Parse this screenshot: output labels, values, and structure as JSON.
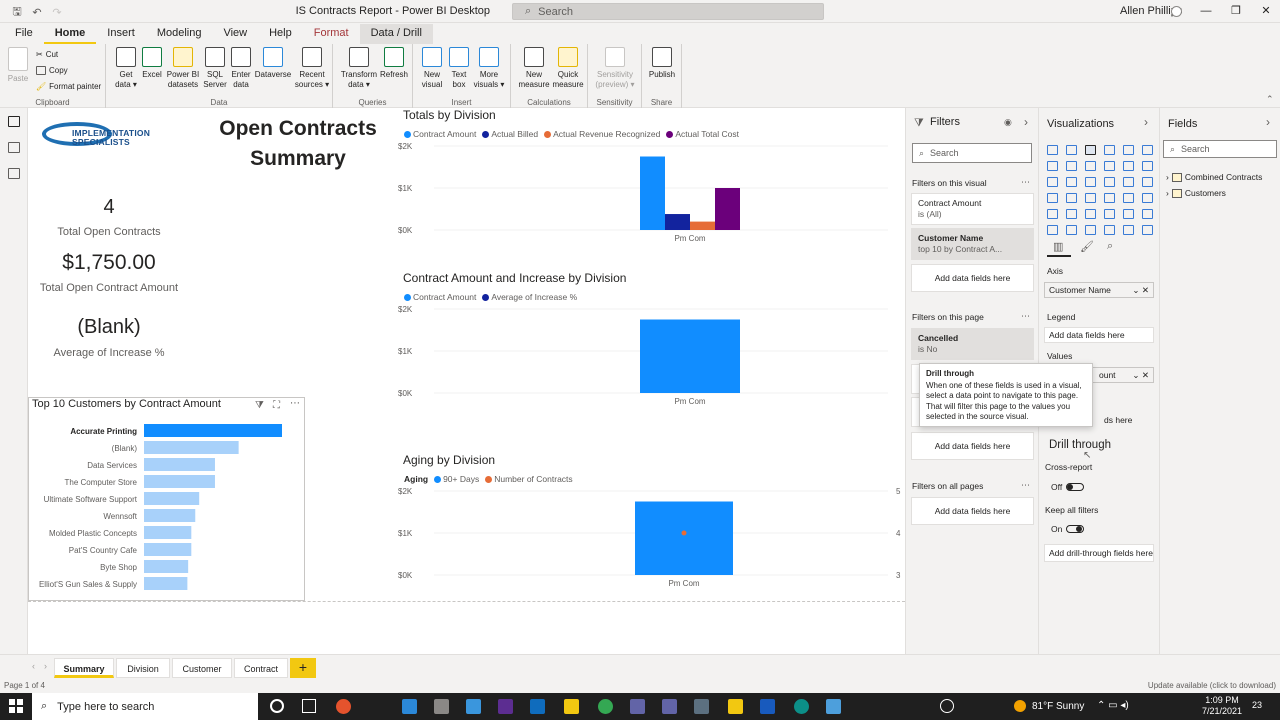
{
  "window": {
    "title": "IS Contracts Report - Power BI Desktop",
    "search_placeholder": "Search",
    "user": "Allen Phillips",
    "icons": [
      "save-icon",
      "undo-icon",
      "redo-icon",
      "search-icon",
      "minimize-icon",
      "restore-icon",
      "close-icon"
    ]
  },
  "ribbon_tabs": [
    "File",
    "Home",
    "Insert",
    "Modeling",
    "View",
    "Help",
    "Format",
    "Data / Drill"
  ],
  "ribbon": {
    "clipboard": {
      "label": "Clipboard",
      "paste": "Paste",
      "cut": "Cut",
      "copy": "Copy",
      "format_painter": "Format painter"
    },
    "data": {
      "label": "Data",
      "get_data_1": "Get",
      "get_data_2": "data ▾",
      "excel": "Excel",
      "datasets_1": "Power BI",
      "datasets_2": "datasets",
      "sql_1": "SQL",
      "sql_2": "Server",
      "enter_1": "Enter",
      "enter_2": "data",
      "dataverse": "Dataverse",
      "recent_1": "Recent",
      "recent_2": "sources ▾"
    },
    "queries": {
      "label": "Queries",
      "transform_1": "Transform",
      "transform_2": "data ▾",
      "refresh": "Refresh"
    },
    "insert": {
      "label": "Insert",
      "new_visual_1": "New",
      "new_visual_2": "visual",
      "text_box_1": "Text",
      "text_box_2": "box",
      "more_1": "More",
      "more_2": "visuals ▾"
    },
    "calculations": {
      "label": "Calculations",
      "new_measure_1": "New",
      "new_measure_2": "measure",
      "quick_1": "Quick",
      "quick_2": "measure"
    },
    "sensitivity": {
      "label": "Sensitivity",
      "s_1": "Sensitivity",
      "s_2": "(preview) ▾"
    },
    "share": {
      "label": "Share",
      "publish": "Publish"
    }
  },
  "report": {
    "logo_line1": "IMPLEMENTATION",
    "logo_line2": "SPECIALISTS",
    "title_line1": "Open Contracts",
    "title_line2": "Summary",
    "kpi_open_value": "4",
    "kpi_open_label": "Total Open Contracts",
    "kpi_amount_value": "$1,750.00",
    "kpi_amount_label": "Total Open Contract Amount",
    "kpi_increase_value": "(Blank)",
    "kpi_increase_label": "Average of Increase %"
  },
  "colors": {
    "contract_amount": "#118DFF",
    "actual_billed": "#12239E",
    "actual_revenue": "#E66C37",
    "actual_cost": "#6B007B",
    "top10_first": "#118DFF",
    "top10_rest": "#a8d1fa",
    "accent": "#F2C811"
  },
  "chart_data": [
    {
      "type": "bar",
      "title": "Totals by Division",
      "categories": [
        "Pm Com"
      ],
      "series": [
        {
          "name": "Contract Amount",
          "values": [
            1750
          ]
        },
        {
          "name": "Actual Billed",
          "values": [
            380
          ]
        },
        {
          "name": "Actual Revenue Recognized",
          "values": [
            200
          ]
        },
        {
          "name": "Actual Total Cost",
          "values": [
            1000
          ]
        }
      ],
      "yticks": [
        "$2K",
        "$1K",
        "$0K"
      ],
      "ylim": [
        0,
        2000
      ]
    },
    {
      "type": "bar",
      "title": "Contract Amount and Increase by Division",
      "categories": [
        "Pm Com"
      ],
      "series": [
        {
          "name": "Contract Amount",
          "values": [
            1750
          ]
        },
        {
          "name": "Average of Increase %",
          "values": [
            null
          ]
        }
      ],
      "yticks": [
        "$2K",
        "$1K",
        "$0K"
      ],
      "ylim": [
        0,
        2000
      ]
    },
    {
      "type": "bar",
      "title": "Aging by Division",
      "legend_title": "Aging",
      "categories": [
        "Pm Com"
      ],
      "series": [
        {
          "name": "90+ Days",
          "values": [
            1750
          ]
        },
        {
          "name": "Number of Contracts",
          "values": [
            4
          ]
        }
      ],
      "yticks": [
        "$2K",
        "$1K",
        "$0K"
      ],
      "y2ticks": [
        "5",
        "4",
        "3"
      ],
      "ylim": [
        0,
        2000
      ],
      "y2lim": [
        3,
        5
      ]
    },
    {
      "type": "bar",
      "orientation": "horizontal",
      "title": "Top 10 Customers by Contract Amount",
      "categories": [
        "Accurate Printing",
        "(Blank)",
        "Data Services",
        "The Computer Store",
        "Ultimate Software Support",
        "Wennsoft",
        "Molded Plastic Concepts",
        "Pat'S Country Cafe",
        "Byte Shop",
        "Elliot'S Gun Sales & Supply"
      ],
      "values": [
        1750,
        1200,
        900,
        900,
        700,
        650,
        600,
        600,
        560,
        550
      ]
    }
  ],
  "filters": {
    "title": "Filters",
    "search": "Search",
    "on_visual": "Filters on this visual",
    "card1_name": "Contract Amount",
    "card1_value": "is (All)",
    "card2_name": "Customer Name",
    "card2_value": "top 10 by Contract A...",
    "add": "Add data fields here",
    "on_page": "Filters on this page",
    "card3_name": "Cancelled",
    "card3_value": "is No",
    "add_page": "Add data fields here",
    "on_all": "Filters on all pages",
    "add_all": "Add data fields here"
  },
  "tooltip": {
    "title": "Drill through",
    "body": "When one of these fields is used in a visual, select a data point to navigate to this page. That will filter this page to the values you selected in the source visual."
  },
  "viz": {
    "title": "Visualizations",
    "axis": "Axis",
    "axis_field": "Customer Name",
    "legend": "Legend",
    "legend_add": "Add data fields here",
    "values": "Values",
    "values_field_tail": "ount",
    "tooltips_add_tail": "ds here",
    "drill_through": "Drill through",
    "cross_report": "Cross-report",
    "cross_state": "Off",
    "keep_filters": "Keep all filters",
    "keep_state": "On",
    "add_drill": "Add drill-through fields here"
  },
  "fields": {
    "title": "Fields",
    "search": "Search",
    "tables": [
      "Combined Contracts",
      "Customers"
    ]
  },
  "pages": [
    "Summary",
    "Division",
    "Customer",
    "Contract"
  ],
  "add_page": "+",
  "status": {
    "page": "Page 1 of 4",
    "update": "Update available (click to download)"
  },
  "taskbar": {
    "search": "Type here to search",
    "weather": "81°F  Sunny",
    "time": "1:09 PM",
    "date": "7/21/2021",
    "notif": "23"
  }
}
